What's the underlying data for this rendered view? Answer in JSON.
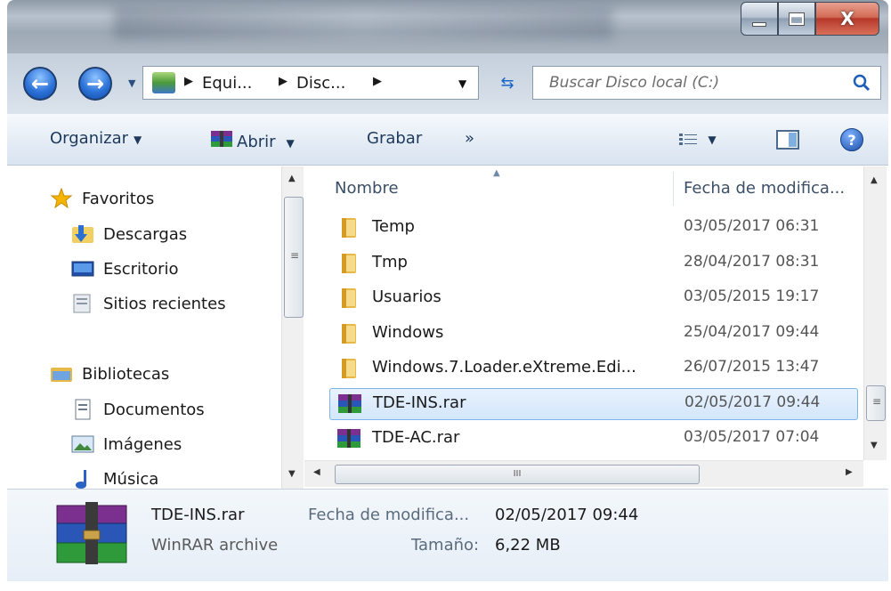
{
  "window": {
    "controls": {
      "minimize_label": "",
      "maximize_label": "",
      "close_label": "X"
    }
  },
  "address": {
    "crumbs": [
      "Equi...",
      "Disc..."
    ],
    "search_placeholder": "Buscar Disco local (C:)"
  },
  "toolbar": {
    "organize": "Organizar",
    "open": "Abrir",
    "burn": "Grabar",
    "more": "»"
  },
  "navigation": {
    "favorites_header": "Favoritos",
    "favorites": [
      "Descargas",
      "Escritorio",
      "Sitios recientes"
    ],
    "libraries_header": "Bibliotecas",
    "libraries": [
      "Documentos",
      "Imágenes",
      "Música"
    ]
  },
  "columns": {
    "name": "Nombre",
    "date": "Fecha de modifica..."
  },
  "files": [
    {
      "name": "Temp",
      "date": "03/05/2017 06:31",
      "type": "folder"
    },
    {
      "name": "Tmp",
      "date": "28/04/2017 08:31",
      "type": "folder"
    },
    {
      "name": "Usuarios",
      "date": "03/05/2015 19:17",
      "type": "folder"
    },
    {
      "name": "Windows",
      "date": "25/04/2017 09:44",
      "type": "folder"
    },
    {
      "name": "Windows.7.Loader.eXtreme.Edi...",
      "date": "26/07/2015 13:47",
      "type": "folder"
    },
    {
      "name": "TDE-INS.rar",
      "date": "02/05/2017 09:44",
      "type": "rar",
      "selected": true
    },
    {
      "name": "TDE-AC.rar",
      "date": "03/05/2017 07:04",
      "type": "rar"
    }
  ],
  "scrollbar": {
    "thumb_grip": "III",
    "v_grip": "≡"
  },
  "details": {
    "filename": "TDE-INS.rar",
    "filetype": "WinRAR archive",
    "date_label": "Fecha de modifica...",
    "date_value": "02/05/2017 09:44",
    "size_label": "Tamaño:",
    "size_value": "6,22 MB"
  },
  "colors": {
    "accent": "#1e395b",
    "selection_border": "#7eb4ea",
    "close_red": "#c4422f"
  },
  "icons": {
    "back": "back-arrow-icon",
    "forward": "forward-arrow-icon",
    "refresh": "refresh-icon",
    "search": "search-icon",
    "help": "help-icon",
    "folder": "folder-icon",
    "rar": "winrar-icon"
  }
}
